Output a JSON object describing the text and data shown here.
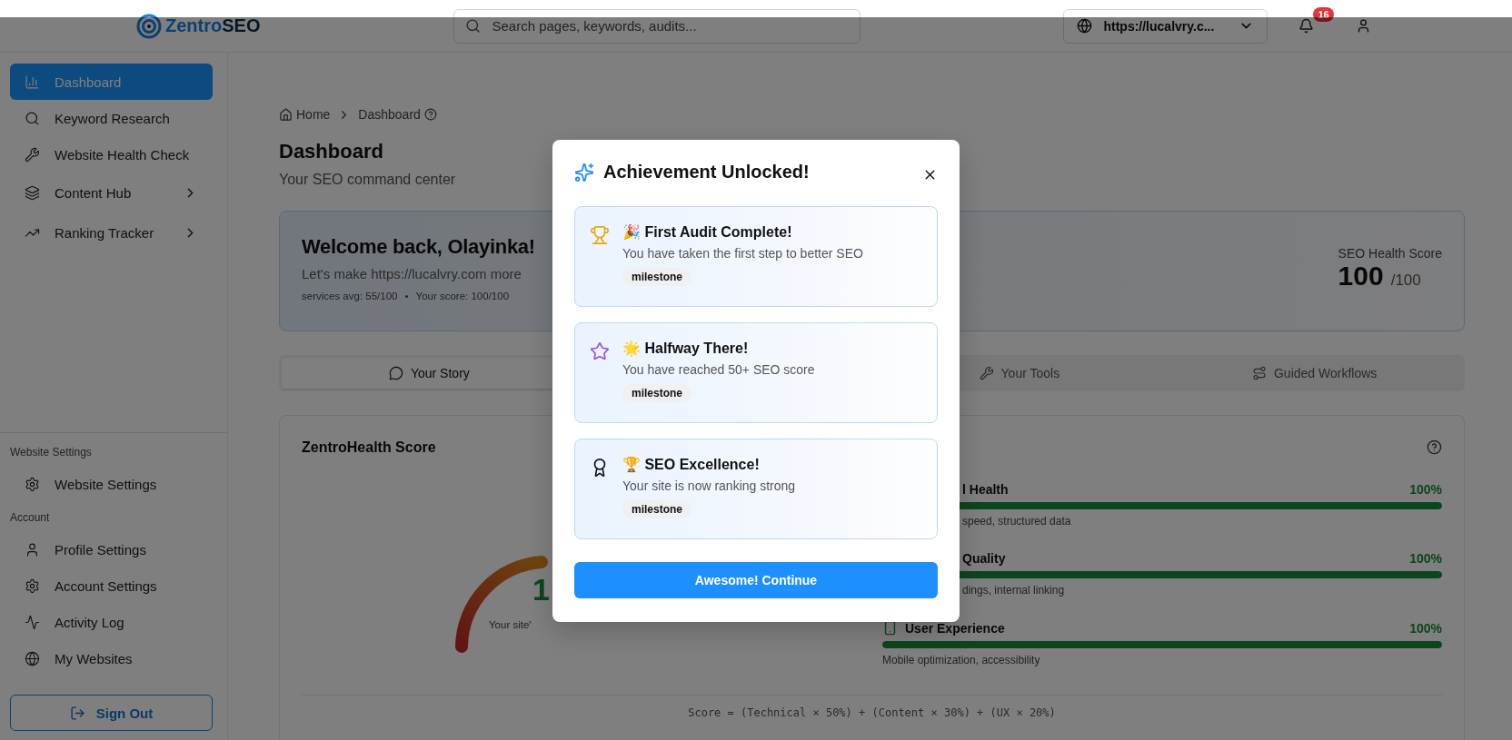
{
  "header": {
    "logo": {
      "part1": "Zentro",
      "part2": "SEO"
    },
    "search": {
      "placeholder": "Search pages, keywords, audits..."
    },
    "site_select": {
      "value": "https://lucalvry.c..."
    },
    "notifications": {
      "count": "16"
    }
  },
  "sidebar": {
    "items": [
      {
        "label": "Dashboard",
        "selected": true,
        "expandable": false
      },
      {
        "label": "Keyword Research",
        "selected": false,
        "expandable": false
      },
      {
        "label": "Website Health Check",
        "selected": false,
        "expandable": false
      },
      {
        "label": "Content Hub",
        "selected": false,
        "expandable": true
      },
      {
        "label": "Ranking Tracker",
        "selected": false,
        "expandable": true
      }
    ],
    "sections": [
      {
        "title": "Website Settings",
        "items": [
          {
            "label": "Website Settings",
            "selected": false
          }
        ]
      },
      {
        "title": "Account",
        "items": [
          {
            "label": "Profile Settings",
            "selected": false
          },
          {
            "label": "Account Settings",
            "selected": false
          },
          {
            "label": "Activity Log",
            "selected": false
          },
          {
            "label": "My Websites",
            "selected": false
          }
        ]
      }
    ],
    "sign_out": "Sign Out"
  },
  "breadcrumb": [
    "Home",
    "Dashboard"
  ],
  "page": {
    "title": "Dashboard",
    "subtitle": "Your SEO command center"
  },
  "welcome": {
    "title": "Welcome back, Olayinka!",
    "text": "Let's make https://lucalvry.com more",
    "stats": [
      "services avg: 55/100",
      "Your score: 100/100"
    ],
    "stats_separator": "•",
    "score_label": "SEO Health Score",
    "score": "100",
    "score_max": "/100"
  },
  "tabs": [
    {
      "label": "Your Story",
      "selected": true
    },
    {
      "label": "Your Tools",
      "selected": false
    },
    {
      "label": "Guided Workflows",
      "selected": false
    }
  ],
  "health": {
    "title": "ZentroHealth Score",
    "gauge_value": "1",
    "gauge_caption": "Your site'",
    "rows": [
      {
        "kind": "partial",
        "name": "l Health",
        "value": "100%",
        "level": 1,
        "desc": "speed, structured data"
      },
      {
        "kind": "partial",
        "name": "Quality",
        "value": "100%",
        "level": 1,
        "desc": "dings, internal linking"
      },
      {
        "kind": "full",
        "name": "User Experience",
        "value": "100%",
        "level": 1,
        "desc": "Mobile optimization, accessibility"
      }
    ],
    "formula": "Score = (Technical × 50%) + (Content × 30%) + (UX × 20%)"
  },
  "modal": {
    "title": "Achievement Unlocked!",
    "achievements": [
      {
        "kind": "trophy",
        "title": "🎉 First Audit Complete!",
        "desc": "You have taken the first step to better SEO",
        "tag": "milestone"
      },
      {
        "kind": "star",
        "title": "🌟 Halfway There!",
        "desc": "You have reached 50+ SEO score",
        "tag": "milestone"
      },
      {
        "kind": "award",
        "title": "🏆 SEO Excellence!",
        "desc": "Your site is now ranking strong",
        "tag": "milestone"
      }
    ],
    "button": "Awesome! Continue"
  }
}
